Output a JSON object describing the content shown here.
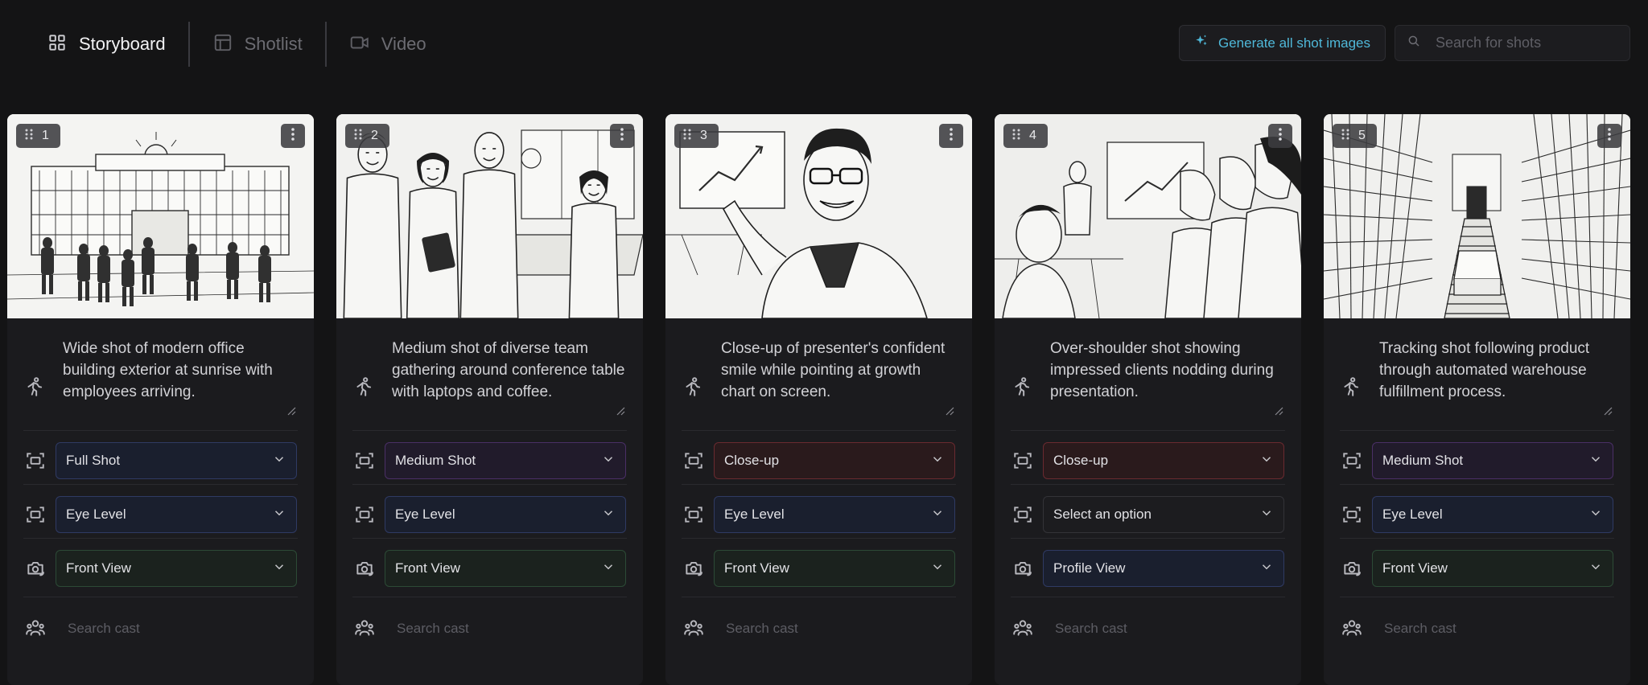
{
  "tabs": [
    {
      "label": "Storyboard",
      "icon": "grid-icon",
      "active": true
    },
    {
      "label": "Shotlist",
      "icon": "table-icon",
      "active": false
    },
    {
      "label": "Video",
      "icon": "video-camera-icon",
      "active": false
    }
  ],
  "toolbar": {
    "generate_label": "Generate all shot images",
    "search_placeholder": "Search for shots"
  },
  "colors": {
    "accent": "#4fb8d9",
    "blue_select_bg": "#1a1f2e",
    "blue_select_border": "#2f3a63",
    "purple_select_bg": "#211b2b",
    "purple_select_border": "#4a2f66",
    "red_select_bg": "#2a1a1c",
    "red_select_border": "#6a2a30",
    "green_select_bg": "#1b221e",
    "green_select_border": "#2c4a36",
    "neutral_select_bg": "#1c1c1f",
    "neutral_select_border": "#333338"
  },
  "shots": [
    {
      "number": "1",
      "description": "Wide shot of modern office building exterior at sunrise with employees arriving.",
      "shot_type": {
        "value": "Full Shot",
        "tone": "blue"
      },
      "angle": {
        "value": "Eye Level",
        "tone": "blue"
      },
      "view": {
        "value": "Front View",
        "tone": "green"
      },
      "cast_placeholder": "Search cast",
      "image": "office-building-sketch"
    },
    {
      "number": "2",
      "description": "Medium shot of diverse team gathering around conference table with laptops and coffee.",
      "shot_type": {
        "value": "Medium Shot",
        "tone": "purple"
      },
      "angle": {
        "value": "Eye Level",
        "tone": "blue"
      },
      "view": {
        "value": "Front View",
        "tone": "green"
      },
      "cast_placeholder": "Search cast",
      "image": "team-meeting-sketch"
    },
    {
      "number": "3",
      "description": "Close-up of presenter's confident smile while pointing at growth chart on screen.",
      "shot_type": {
        "value": "Close-up",
        "tone": "red"
      },
      "angle": {
        "value": "Eye Level",
        "tone": "blue"
      },
      "view": {
        "value": "Front View",
        "tone": "green"
      },
      "cast_placeholder": "Search cast",
      "image": "presenter-sketch"
    },
    {
      "number": "4",
      "description": "Over-shoulder shot showing impressed clients nodding during presentation.",
      "shot_type": {
        "value": "Close-up",
        "tone": "red"
      },
      "angle": {
        "value": "Select an option",
        "tone": "neutral"
      },
      "view": {
        "value": "Profile View",
        "tone": "blue"
      },
      "cast_placeholder": "Search cast",
      "image": "clients-sketch"
    },
    {
      "number": "5",
      "description": "Tracking shot following product through automated warehouse fulfillment process.",
      "shot_type": {
        "value": "Medium Shot",
        "tone": "purple"
      },
      "angle": {
        "value": "Eye Level",
        "tone": "blue"
      },
      "view": {
        "value": "Front View",
        "tone": "green"
      },
      "cast_placeholder": "Search cast",
      "image": "warehouse-sketch"
    }
  ]
}
